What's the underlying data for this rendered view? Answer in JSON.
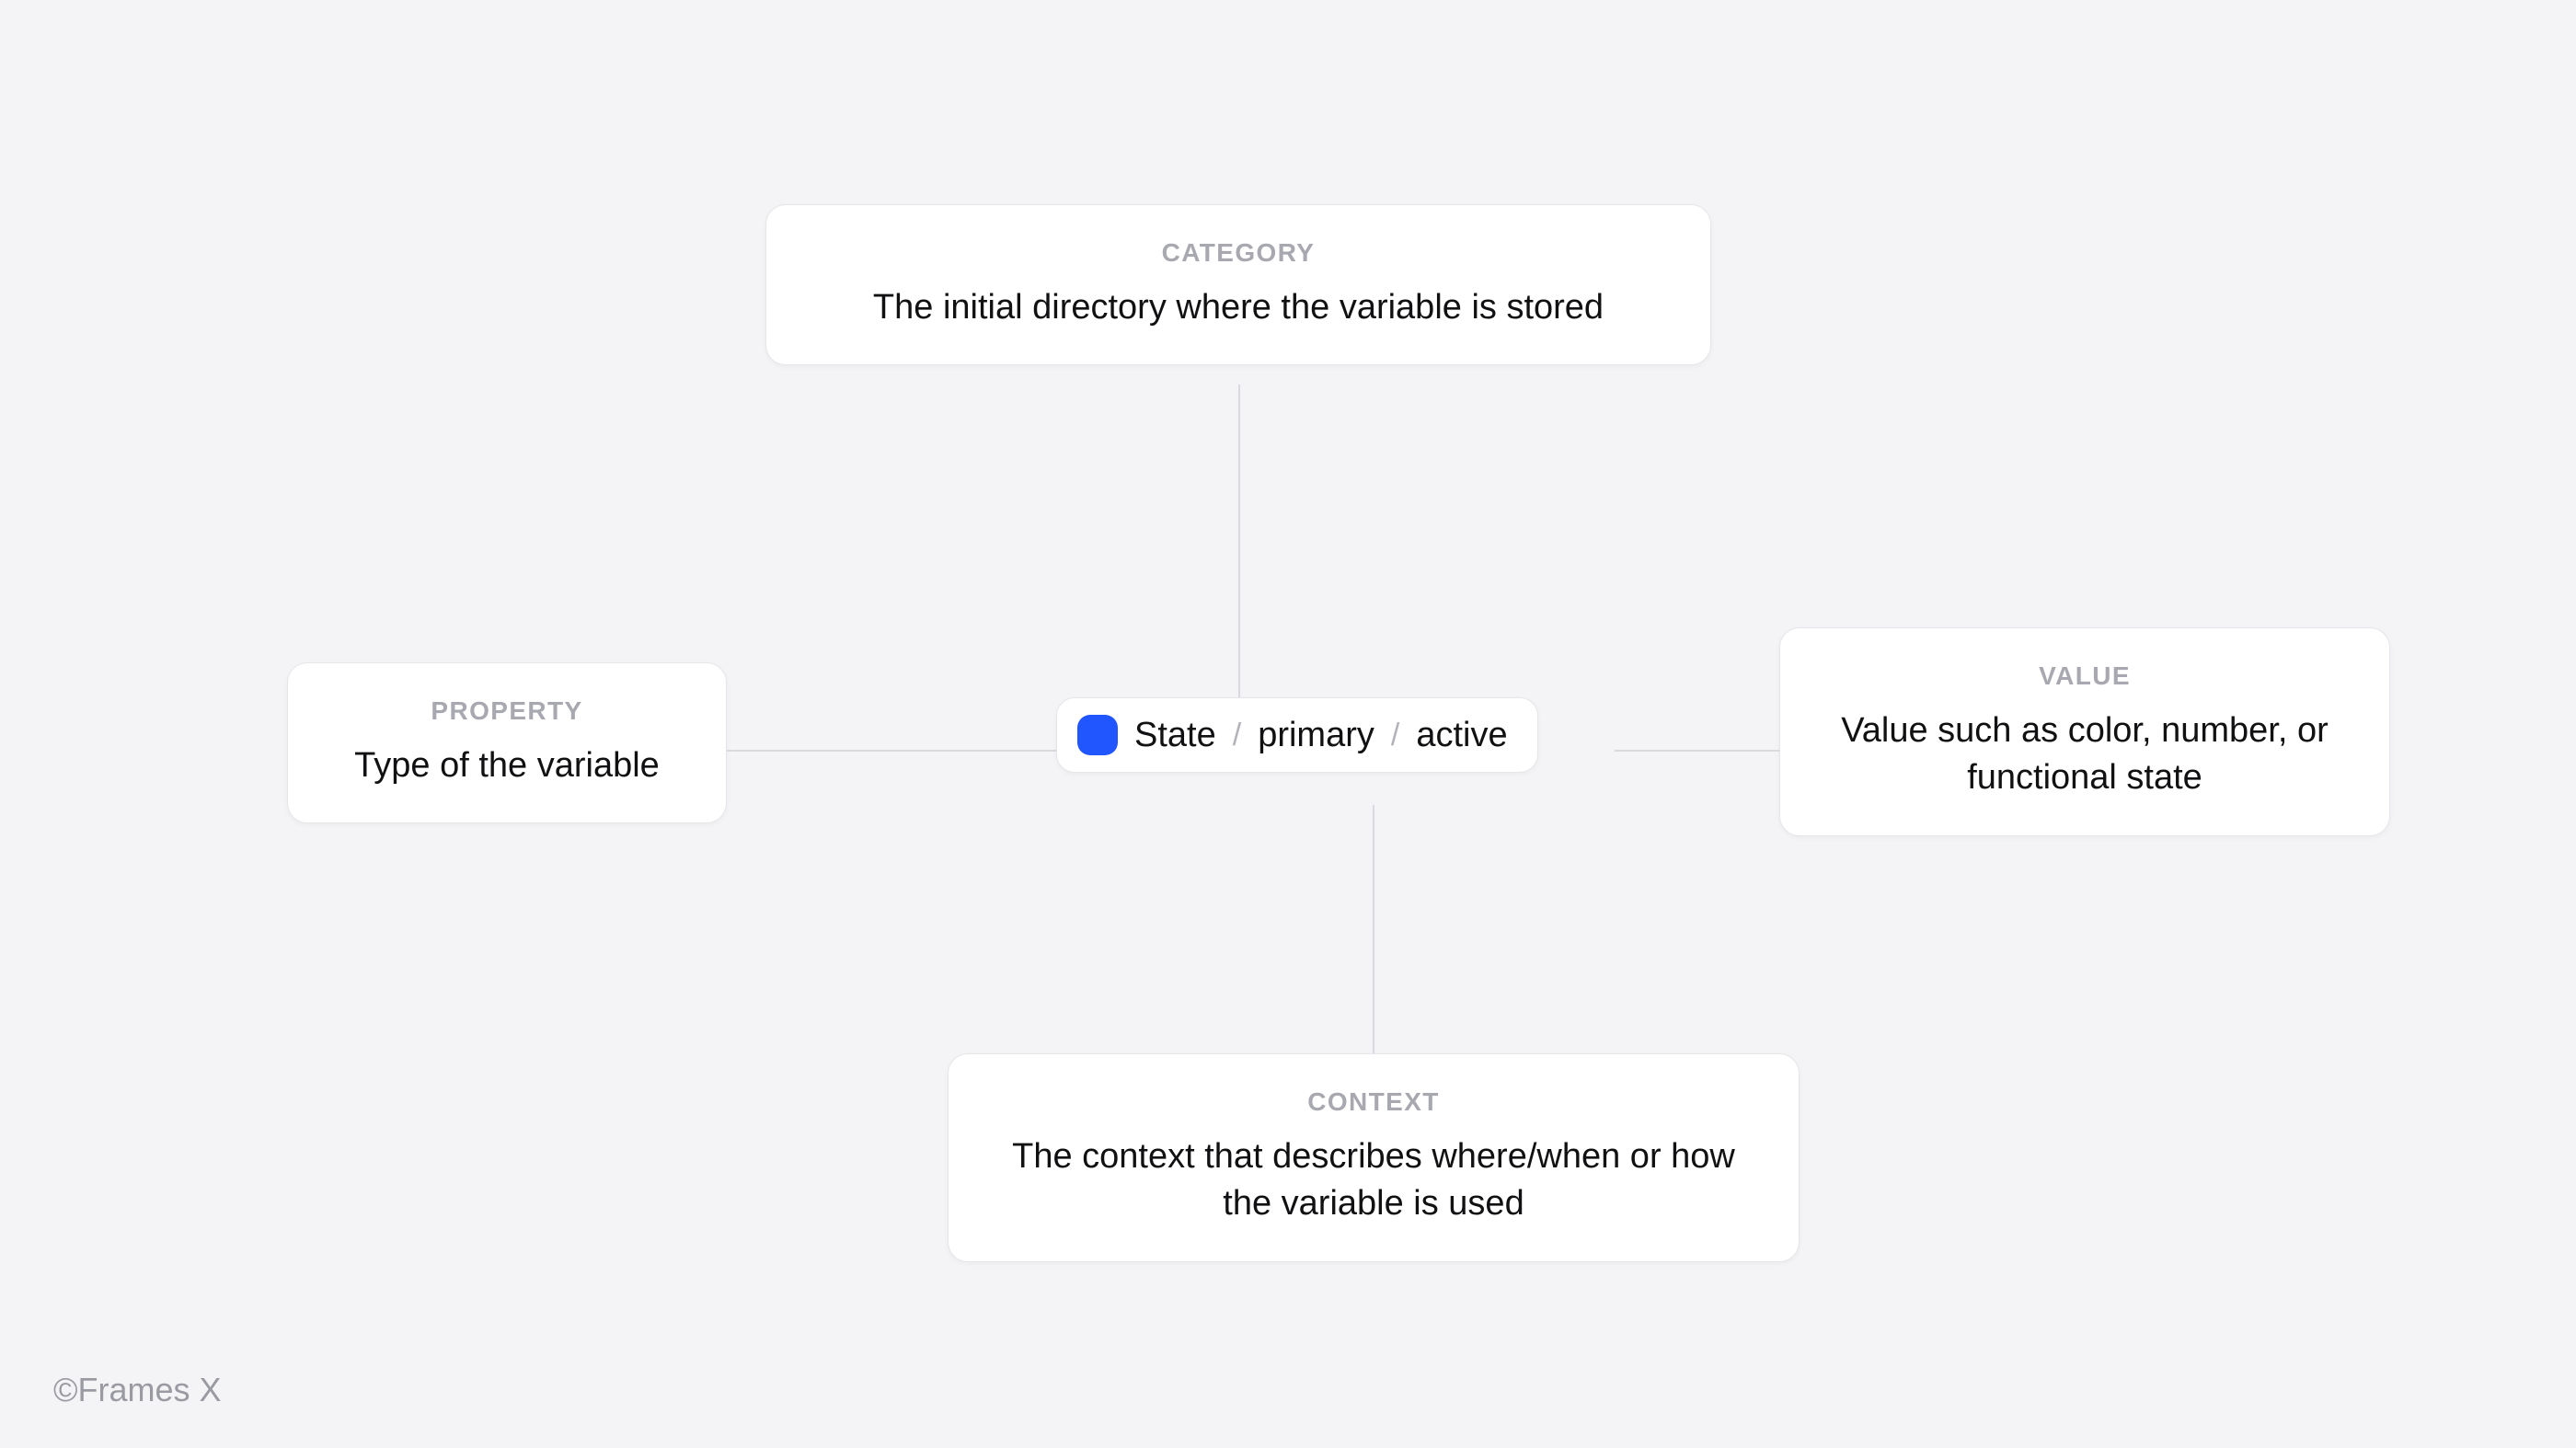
{
  "token": {
    "swatch_color": "#2156ff",
    "part1": "State",
    "part2": "primary",
    "part3": "active",
    "separator": "/"
  },
  "category": {
    "label": "CATEGORY",
    "desc": "The initial directory where the variable is stored"
  },
  "property": {
    "label": "PROPERTY",
    "desc": "Type of the variable"
  },
  "value": {
    "label": "VALUE",
    "desc": "Value such as color, number, or functional state"
  },
  "context": {
    "label": "CONTEXT",
    "desc": "The context that describes where/when or how the variable is used"
  },
  "footer": "©Frames X"
}
